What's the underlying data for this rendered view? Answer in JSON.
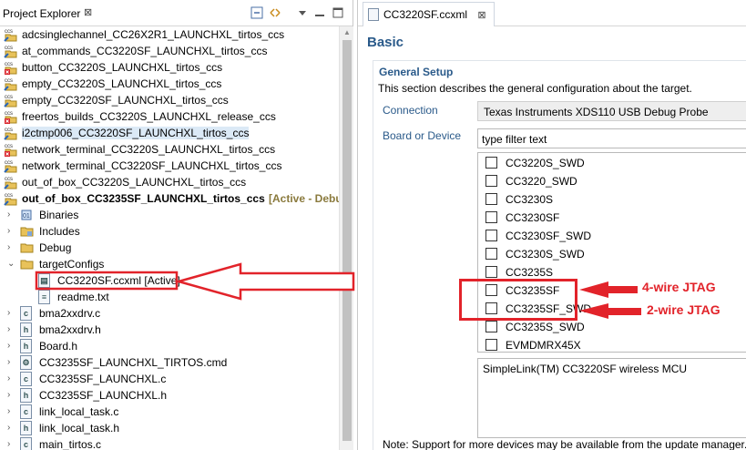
{
  "explorer": {
    "title": "Project Explorer",
    "close_glyph": "⊠",
    "items": [
      {
        "label": "adcsinglechannel_CC26X2R1_LAUNCHXL_tirtos_ccs",
        "kind": "ccs-project"
      },
      {
        "label": "at_commands_CC3220SF_LAUNCHXL_tirtos_ccs",
        "kind": "ccs-project"
      },
      {
        "label": "button_CC3220S_LAUNCHXL_tirtos_ccs",
        "kind": "ccs-project-error"
      },
      {
        "label": "empty_CC3220S_LAUNCHXL_tirtos_ccs",
        "kind": "ccs-project"
      },
      {
        "label": "empty_CC3220SF_LAUNCHXL_tirtos_ccs",
        "kind": "ccs-project"
      },
      {
        "label": "freertos_builds_CC3220S_LAUNCHXL_release_ccs",
        "kind": "ccs-project-error"
      },
      {
        "label": "i2ctmp006_CC3220SF_LAUNCHXL_tirtos_ccs",
        "kind": "ccs-project"
      },
      {
        "label": "network_terminal_CC3220S_LAUNCHXL_tirtos_ccs",
        "kind": "ccs-project-error"
      },
      {
        "label": "network_terminal_CC3220SF_LAUNCHXL_tirtos_ccs",
        "kind": "ccs-project"
      },
      {
        "label": "out_of_box_CC3220S_LAUNCHXL_tirtos_ccs",
        "kind": "ccs-project"
      },
      {
        "label": "out_of_box_CC3235SF_LAUNCHXL_tirtos_ccs",
        "kind": "ccs-project-active",
        "tag": "[Active - Debug]"
      }
    ],
    "children": [
      {
        "label": "Binaries",
        "icon": "binaries-icon"
      },
      {
        "label": "Includes",
        "icon": "includes-icon"
      },
      {
        "label": "Debug",
        "icon": "folder-icon"
      },
      {
        "label": "targetConfigs",
        "icon": "folder-open-icon"
      },
      {
        "label": "CC3220SF.ccxml [Active]",
        "icon": "ccxml-file-icon"
      },
      {
        "label": "readme.txt",
        "icon": "text-file-icon"
      },
      {
        "label": "bma2xxdrv.c",
        "icon": "c-file-icon"
      },
      {
        "label": "bma2xxdrv.h",
        "icon": "h-file-icon"
      },
      {
        "label": "Board.h",
        "icon": "h-file-icon"
      },
      {
        "label": "CC3235SF_LAUNCHXL_TIRTOS.cmd",
        "icon": "cmd-file-icon"
      },
      {
        "label": "CC3235SF_LAUNCHXL.c",
        "icon": "c-file-icon"
      },
      {
        "label": "CC3235SF_LAUNCHXL.h",
        "icon": "h-file-icon"
      },
      {
        "label": "link_local_task.c",
        "icon": "c-file-icon"
      },
      {
        "label": "link_local_task.h",
        "icon": "h-file-icon"
      },
      {
        "label": "main_tirtos.c",
        "icon": "c-file-icon"
      }
    ]
  },
  "editor": {
    "tab_title": "CC3220SF.ccxml",
    "tab_close": "⊠",
    "heading": "Basic",
    "section_title": "General Setup",
    "section_desc": "This section describes the general configuration about the target.",
    "connection_label": "Connection",
    "connection_value": "Texas Instruments XDS110 USB Debug Probe",
    "board_label": "Board or Device",
    "filter_value": "type filter text",
    "devices": [
      {
        "label": "CC3220S_SWD",
        "checked": false
      },
      {
        "label": "CC3220_SWD",
        "checked": false
      },
      {
        "label": "CC3230S",
        "checked": false
      },
      {
        "label": "CC3230SF",
        "checked": false
      },
      {
        "label": "CC3230SF_SWD",
        "checked": false
      },
      {
        "label": "CC3230S_SWD",
        "checked": false
      },
      {
        "label": "CC3235S",
        "checked": false
      },
      {
        "label": "CC3235SF",
        "checked": false
      },
      {
        "label": "CC3235SF_SWD",
        "checked": false
      },
      {
        "label": "CC3235S_SWD",
        "checked": false
      },
      {
        "label": "EVMDMRX45X",
        "checked": false
      }
    ],
    "description": "SimpleLink(TM) CC3220SF wireless MCU",
    "note": "Note: Support for more devices may be available from the update manager."
  },
  "annotations": {
    "jtag4": "4-wire JTAG",
    "jtag2": "2-wire JTAG",
    "color": "#e2232a"
  }
}
